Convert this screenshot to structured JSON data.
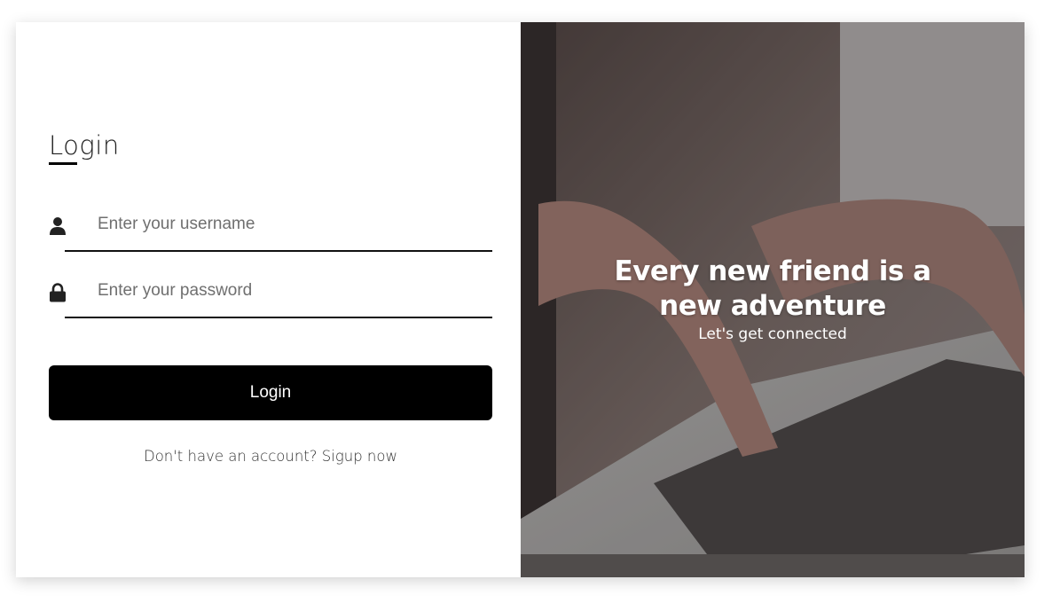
{
  "login_form": {
    "title": "Login",
    "username": {
      "placeholder": "Enter your username",
      "value": "",
      "icon": "user-icon"
    },
    "password": {
      "placeholder": "Enter your password",
      "value": "",
      "icon": "lock-icon"
    },
    "submit_label": "Login",
    "signup_prompt": "Don't have an account?",
    "signup_link": "Sigup now"
  },
  "hero": {
    "headline_line1": "Every new friend is a",
    "headline_line2": "new adventure",
    "subheadline": "Let's get connected"
  },
  "colors": {
    "button": "#000000",
    "button_text": "#ffffff",
    "underline": "#111111"
  }
}
